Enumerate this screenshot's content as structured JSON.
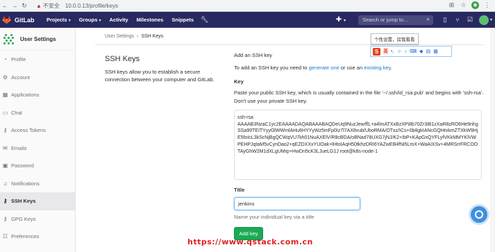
{
  "browser": {
    "insecure_label": "不安全",
    "url": "10.0.0.13/profile/keys"
  },
  "topbar": {
    "brand": "GitLab",
    "nav": [
      "Projects",
      "Groups",
      "Activity",
      "Milestones",
      "Snippets"
    ],
    "search_placeholder": "Search or jump to..."
  },
  "sidebar": {
    "title": "User Settings",
    "items": [
      {
        "label": "Profile",
        "icon": "user-icon"
      },
      {
        "label": "Account",
        "icon": "gear-icon"
      },
      {
        "label": "Applications",
        "icon": "grid-icon"
      },
      {
        "label": "Chat",
        "icon": "chat-icon"
      },
      {
        "label": "Access Tokens",
        "icon": "key-icon"
      },
      {
        "label": "Emails",
        "icon": "envelope-icon"
      },
      {
        "label": "Password",
        "icon": "lock-icon"
      },
      {
        "label": "Notifications",
        "icon": "bell-icon"
      },
      {
        "label": "SSH Keys",
        "icon": "key-icon",
        "active": true
      },
      {
        "label": "GPG Keys",
        "icon": "key-icon"
      },
      {
        "label": "Preferences",
        "icon": "sliders-icon"
      }
    ]
  },
  "breadcrumb": {
    "parent": "User Settings",
    "current": "SSH Keys"
  },
  "intro": {
    "heading": "SSH Keys",
    "description": "SSH keys allow you to establish a secure connection between your computer and GitLab."
  },
  "add_key": {
    "title": "Add an SSH key",
    "text_before": "To add an SSH key you need to ",
    "link_generate": "generate one",
    "text_middle": " or use an ",
    "link_existing": "existing key",
    "text_end": "."
  },
  "key_field": {
    "label": "Key",
    "help": "Paste your public SSH key, which is usually contained in the file '~/.ssh/id_rsa.pub' and begins with 'ssh-rsa'. Don't use your private SSH key.",
    "value": "ssh-rsa\nAAAAB3NzaC1yc2EAAAADAQABAAABAQDeUq9NuzJew/flL+a4lmATXxBzXPi8b70Zr3iB1zXaR8zRO6He9nhgSSa99TEITYyyOlWWmlAHu6HYYyWz5mFp0Iz7l7AX8vub/UboRMA/OTxz/ICs+0b8gkIANcGQHtvkmZTXkW9HjE5foIcL3kScNjBgQCWqVU7kh01NuAXElV/R8cBDA/oBNad78UXG7jNJ/K2+IbP+KApGxQYFLyfVKkMMYKlVWPEHPJqtaM5vCynDao2+qEZDXXxYUOak+lHtoIAqH50tkhzDRI6YAZwEB4fNi5LmX+WaAIXSv+4MRSrrFRCOOTAyGhW2M1dXLgUMrp+HwDn5cK3LJueLG1J root@k8s-node-1"
  },
  "title_field": {
    "label": "Title",
    "value": "jenkins",
    "help": "Name your individual key via a title"
  },
  "add_button": "Add key",
  "tooltip": "个性设置，房我看看",
  "ime": {
    "logo": "S",
    "lang": "英"
  },
  "watermark": "https://www.qstack.com.cn"
}
